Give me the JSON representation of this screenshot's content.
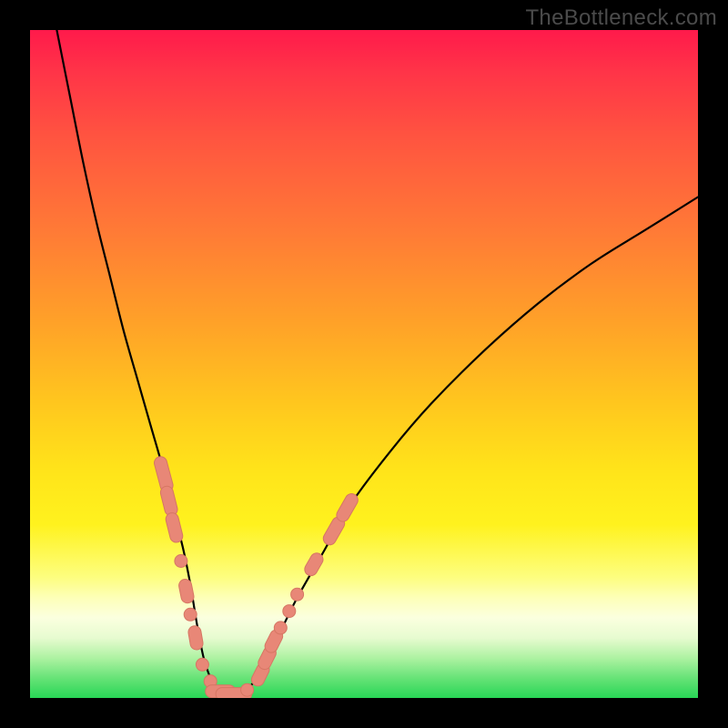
{
  "watermark": "TheBottleneck.com",
  "colors": {
    "frame": "#000000",
    "curve": "#000000",
    "marker_fill": "#e88777",
    "marker_stroke": "#d67663"
  },
  "chart_data": {
    "type": "line",
    "title": "",
    "xlabel": "",
    "ylabel": "",
    "xlim": [
      0,
      100
    ],
    "ylim": [
      0,
      100
    ],
    "grid": false,
    "legend": false,
    "series": [
      {
        "name": "bottleneck-curve",
        "x": [
          4,
          6,
          8,
          10,
          12,
          14,
          16,
          18,
          20,
          22,
          23,
          24,
          25,
          26,
          27,
          28,
          30,
          32,
          34,
          36,
          38,
          40,
          44,
          48,
          54,
          60,
          68,
          76,
          84,
          92,
          100
        ],
        "y": [
          100,
          90,
          80,
          71,
          63,
          55,
          48,
          41,
          34,
          26,
          22,
          17,
          11,
          6,
          3,
          1,
          0,
          1,
          3,
          7,
          11,
          15,
          22,
          29,
          37,
          44,
          52,
          59,
          65,
          70,
          75
        ]
      }
    ],
    "markers": [
      {
        "x": 20.0,
        "y": 33.5,
        "shape": "pill",
        "len": 6
      },
      {
        "x": 20.8,
        "y": 29.5,
        "shape": "pill",
        "len": 5
      },
      {
        "x": 21.6,
        "y": 25.5,
        "shape": "pill",
        "len": 5
      },
      {
        "x": 22.6,
        "y": 20.5,
        "shape": "dot"
      },
      {
        "x": 23.4,
        "y": 16.0,
        "shape": "pill",
        "len": 4
      },
      {
        "x": 24.0,
        "y": 12.5,
        "shape": "dot"
      },
      {
        "x": 24.8,
        "y": 9.0,
        "shape": "pill",
        "len": 4
      },
      {
        "x": 25.8,
        "y": 5.0,
        "shape": "dot"
      },
      {
        "x": 27.0,
        "y": 2.5,
        "shape": "dot"
      },
      {
        "x": 28.5,
        "y": 1.0,
        "shape": "pill-h",
        "len": 5
      },
      {
        "x": 30.5,
        "y": 0.6,
        "shape": "pill-h",
        "len": 6
      },
      {
        "x": 32.5,
        "y": 1.2,
        "shape": "dot"
      },
      {
        "x": 34.5,
        "y": 3.5,
        "shape": "pill",
        "len": 4
      },
      {
        "x": 35.5,
        "y": 6.0,
        "shape": "pill",
        "len": 4
      },
      {
        "x": 36.5,
        "y": 8.5,
        "shape": "pill",
        "len": 4
      },
      {
        "x": 37.5,
        "y": 10.5,
        "shape": "dot"
      },
      {
        "x": 38.8,
        "y": 13.0,
        "shape": "dot"
      },
      {
        "x": 40.0,
        "y": 15.5,
        "shape": "dot"
      },
      {
        "x": 42.5,
        "y": 20.0,
        "shape": "pill",
        "len": 4
      },
      {
        "x": 45.5,
        "y": 25.0,
        "shape": "pill",
        "len": 5
      },
      {
        "x": 47.5,
        "y": 28.5,
        "shape": "pill",
        "len": 5
      }
    ]
  }
}
